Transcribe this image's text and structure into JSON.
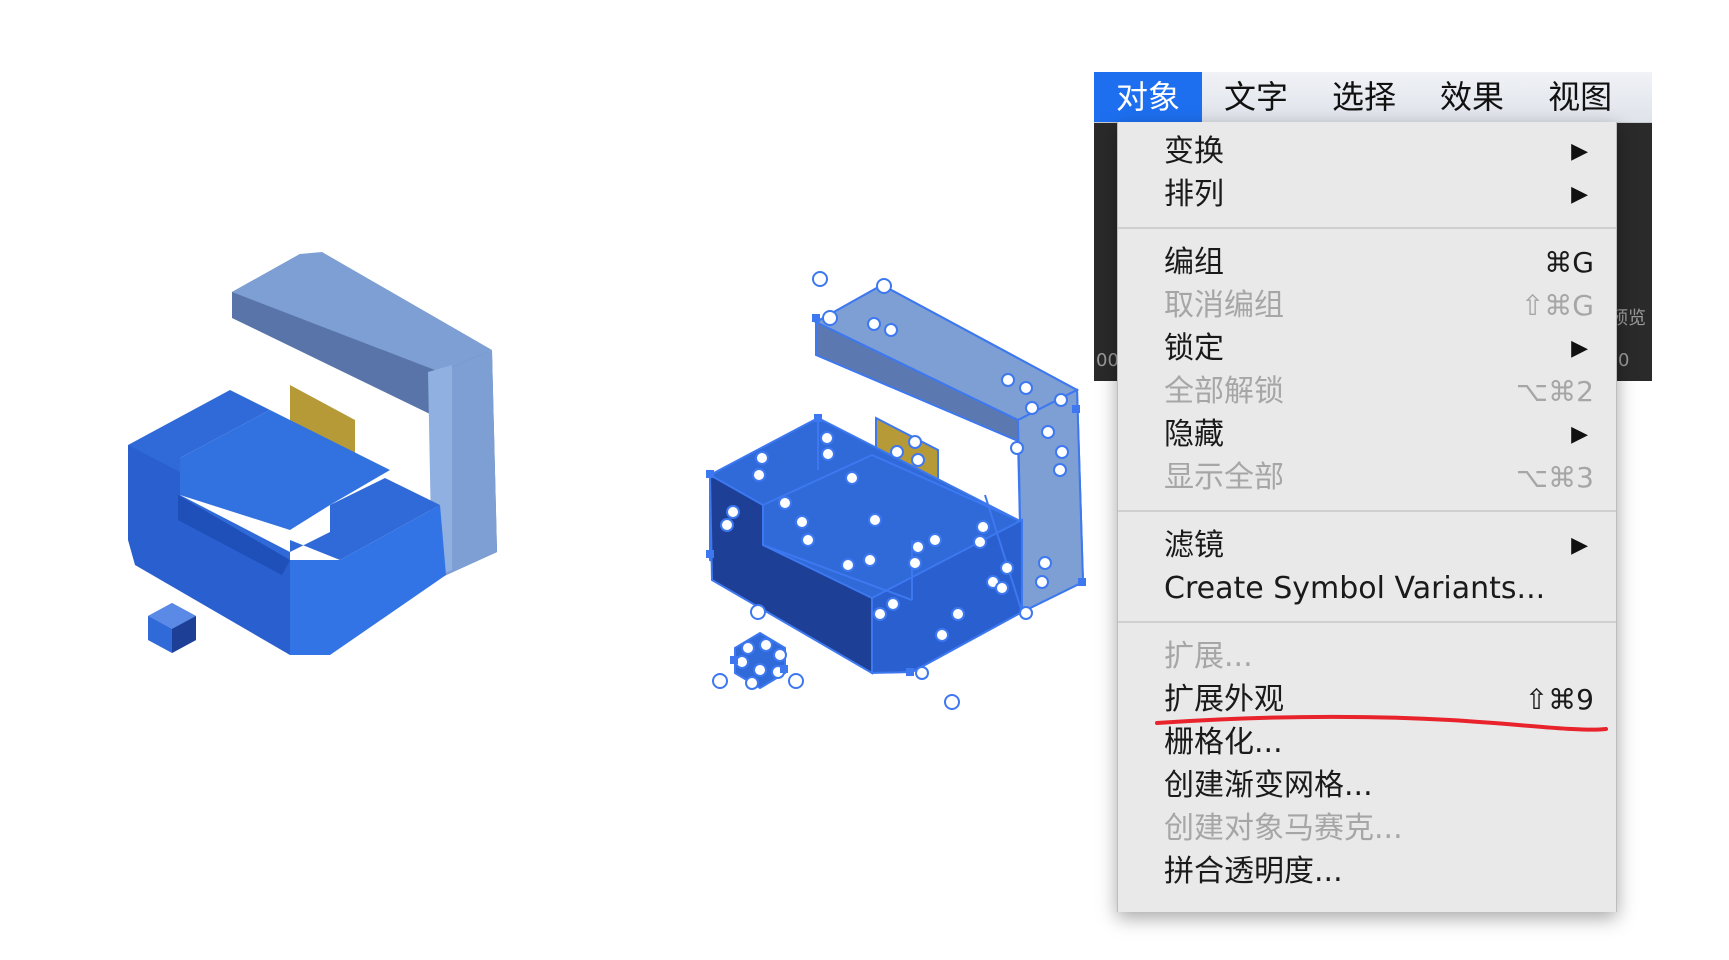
{
  "menubar": {
    "items": [
      "对象",
      "文字",
      "选择",
      "效果",
      "视图"
    ],
    "active_index": 0
  },
  "background_strip": {
    "texts": [
      "00",
      "0",
      "预览"
    ]
  },
  "menu": {
    "groups": [
      [
        {
          "label": "变换",
          "shortcut": "",
          "submenu": true,
          "enabled": true
        },
        {
          "label": "排列",
          "shortcut": "",
          "submenu": true,
          "enabled": true
        }
      ],
      [
        {
          "label": "编组",
          "shortcut": "⌘G",
          "submenu": false,
          "enabled": true
        },
        {
          "label": "取消编组",
          "shortcut": "⇧⌘G",
          "submenu": false,
          "enabled": false
        },
        {
          "label": "锁定",
          "shortcut": "",
          "submenu": true,
          "enabled": true
        },
        {
          "label": "全部解锁",
          "shortcut": "⌥⌘2",
          "submenu": false,
          "enabled": false
        },
        {
          "label": "隐藏",
          "shortcut": "",
          "submenu": true,
          "enabled": true
        },
        {
          "label": "显示全部",
          "shortcut": "⌥⌘3",
          "submenu": false,
          "enabled": false
        }
      ],
      [
        {
          "label": "滤镜",
          "shortcut": "",
          "submenu": true,
          "enabled": true
        },
        {
          "label": "Create Symbol Variants...",
          "shortcut": "",
          "submenu": false,
          "enabled": true
        }
      ],
      [
        {
          "label": "扩展...",
          "shortcut": "",
          "submenu": false,
          "enabled": false
        },
        {
          "label": "扩展外观",
          "shortcut": "⇧⌘9",
          "submenu": false,
          "enabled": true
        },
        {
          "label": "栅格化...",
          "shortcut": "",
          "submenu": false,
          "enabled": true
        },
        {
          "label": "创建渐变网格...",
          "shortcut": "",
          "submenu": false,
          "enabled": true
        },
        {
          "label": "创建对象马赛克...",
          "shortcut": "",
          "submenu": false,
          "enabled": false
        },
        {
          "label": "拼合透明度...",
          "shortcut": "",
          "submenu": false,
          "enabled": true
        }
      ]
    ]
  },
  "icons": {
    "submenu_arrow": "▶",
    "sofa_original": "isometric-sofa-icon",
    "sofa_selected": "isometric-sofa-selected-icon"
  },
  "colors": {
    "sofa_front": "#2f6ad8",
    "sofa_dark": "#1d3f96",
    "sofa_back": "#7d9fd3",
    "sofa_side": "#5874a8",
    "cushion": "#b59a37",
    "selection": "#3d78f0",
    "annotation": "#e8232b",
    "menu_active": "#1d6ff0"
  }
}
